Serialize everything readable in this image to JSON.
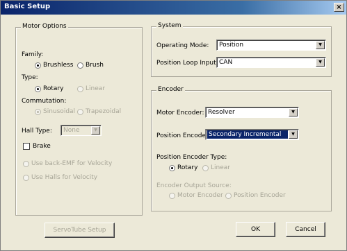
{
  "window": {
    "title": "Basic Setup",
    "close_glyph": "×"
  },
  "motor_options": {
    "legend": "Motor Options",
    "family_label": "Family:",
    "family_options": [
      "Brushless",
      "Brush"
    ],
    "family_selected": "Brushless",
    "type_label": "Type:",
    "type_options": [
      "Rotary",
      "Linear"
    ],
    "type_selected": "Rotary",
    "commutation_label": "Commutation:",
    "commutation_options": [
      "Sinusoidal",
      "Trapezoidal"
    ],
    "commutation_selected": "Sinusoidal",
    "hall_type_label": "Hall Type:",
    "hall_type_value": "None",
    "brake_label": "Brake",
    "brake_checked": false,
    "back_emf_label": "Use back-EMF for Velocity",
    "halls_velocity_label": "Use Halls for Velocity"
  },
  "system": {
    "legend": "System",
    "operating_mode_label": "Operating Mode:",
    "operating_mode_value": "Position",
    "position_loop_label": "Position Loop Input:",
    "position_loop_value": "CAN"
  },
  "encoder": {
    "legend": "Encoder",
    "motor_encoder_label": "Motor Encoder:",
    "motor_encoder_value": "Resolver",
    "position_encoder_label": "Position Encoder:",
    "position_encoder_value": "Secondary Incremental",
    "position_encoder_type_label": "Position Encoder Type:",
    "position_encoder_type_options": [
      "Rotary",
      "Linear"
    ],
    "position_encoder_type_selected": "Rotary",
    "output_source_label": "Encoder Output Source:",
    "output_source_options": [
      "Motor Encoder",
      "Position Encoder"
    ]
  },
  "buttons": {
    "servotube": "ServoTube Setup",
    "ok": "OK",
    "cancel": "Cancel"
  },
  "colors": {
    "window_bg": "#ece9d8",
    "titlebar": "#0a246a",
    "selection": "#0a246a",
    "disabled_text": "#a7a597"
  }
}
